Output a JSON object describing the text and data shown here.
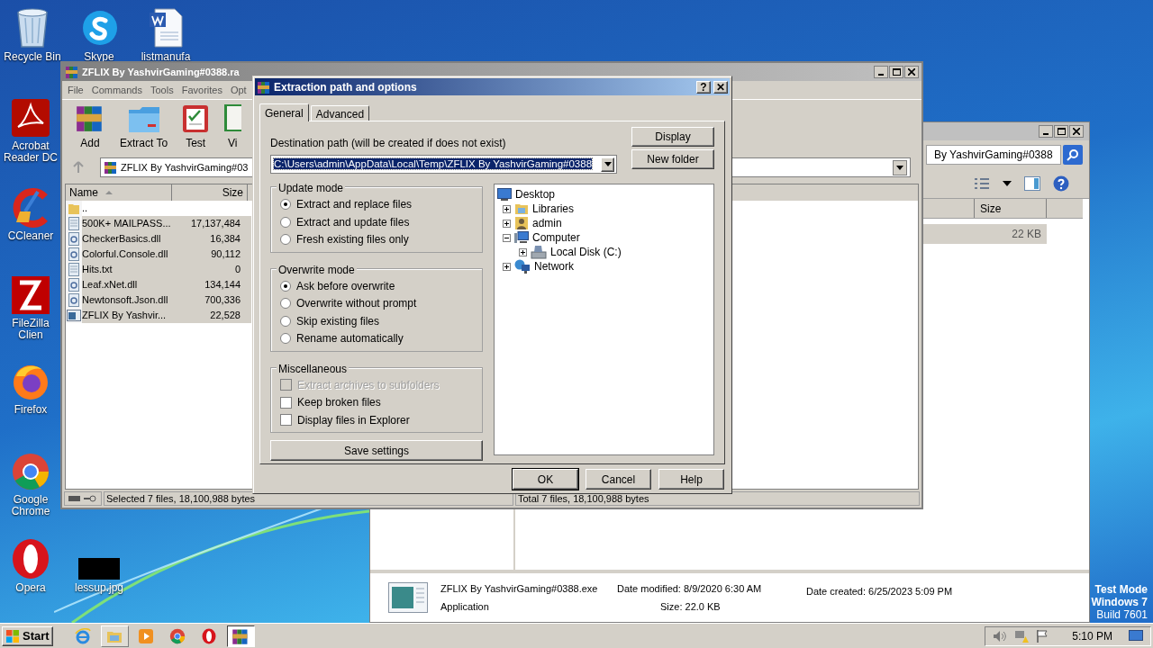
{
  "desktop": {
    "icons": [
      {
        "label": "Recycle Bin",
        "kind": "recycle"
      },
      {
        "label": "Skype",
        "kind": "skype"
      },
      {
        "label": "listmanufa",
        "kind": "word"
      },
      {
        "label": "Acrobat Reader DC",
        "kind": "acrobat"
      },
      {
        "label": "CCleaner",
        "kind": "ccleaner"
      },
      {
        "label": "FileZilla Clien",
        "kind": "filezilla"
      },
      {
        "label": "Firefox",
        "kind": "firefox"
      },
      {
        "label": "Google Chrome",
        "kind": "chrome"
      },
      {
        "label": "Opera",
        "kind": "opera"
      },
      {
        "label": "lessup.jpg",
        "kind": "image"
      }
    ],
    "os_notice": [
      "Test Mode",
      "Windows 7",
      "Build 7601"
    ]
  },
  "explorer": {
    "search_text": "By YashvirGaming#0388",
    "columns": [
      "Size"
    ],
    "rows": [
      {
        "size": "22 KB",
        "selected": true
      }
    ],
    "details": {
      "name": "ZFLIX By YashvirGaming#0388.exe",
      "type": "Application",
      "modified_label": "Date modified:",
      "modified": "8/9/2020 6:30 AM",
      "size_label": "Size:",
      "size": "22.0 KB",
      "created_label": "Date created:",
      "created": "6/25/2023 5:09 PM"
    }
  },
  "winrar": {
    "title": "ZFLIX By YashvirGaming#0388.ra",
    "menu": [
      "File",
      "Commands",
      "Tools",
      "Favorites",
      "Opt"
    ],
    "toolbar": [
      {
        "label": "Add",
        "kind": "add"
      },
      {
        "label": "Extract To",
        "kind": "extract"
      },
      {
        "label": "Test",
        "kind": "test"
      },
      {
        "label": "Vi",
        "kind": "view"
      }
    ],
    "address": "ZFLIX By YashvirGaming#03",
    "columns": [
      "Name",
      "Size"
    ],
    "files": [
      {
        "name": "..",
        "kind": "up",
        "selected": false
      },
      {
        "name": "500K+ MAILPASS...",
        "size": "17,137,484",
        "kind": "text",
        "selected": true
      },
      {
        "name": "CheckerBasics.dll",
        "size": "16,384",
        "kind": "dll",
        "selected": true
      },
      {
        "name": "Colorful.Console.dll",
        "size": "90,112",
        "kind": "dll",
        "selected": true
      },
      {
        "name": "Hits.txt",
        "size": "0",
        "kind": "text",
        "selected": true
      },
      {
        "name": "Leaf.xNet.dll",
        "size": "134,144",
        "kind": "dll",
        "selected": true
      },
      {
        "name": "Newtonsoft.Json.dll",
        "size": "700,336",
        "kind": "dll",
        "selected": true
      },
      {
        "name": "ZFLIX By Yashvir...",
        "size": "22,528",
        "kind": "exe",
        "selected": true
      }
    ],
    "status_left": "Selected 7 files, 18,100,988 bytes",
    "status_right": "Total 7 files, 18,100,988 bytes"
  },
  "dialog": {
    "title": "Extraction path and options",
    "help_button": "?",
    "close_button": "✕",
    "tabs": [
      {
        "label": "General",
        "selected": true
      },
      {
        "label": "Advanced",
        "selected": false
      }
    ],
    "destination_label": "Destination path (will be created if does not exist)",
    "destination": {
      "value": "C:\\Users\\admin\\AppData\\Local\\Temp\\ZFLIX By YashvirGaming#0388",
      "text_selected": true
    },
    "side_buttons": [
      "Display",
      "New folder"
    ],
    "update_mode": {
      "title": "Update mode",
      "options": [
        {
          "label": "Extract and replace files",
          "selected": true
        },
        {
          "label": "Extract and update files",
          "selected": false
        },
        {
          "label": "Fresh existing files only",
          "selected": false
        }
      ]
    },
    "overwrite_mode": {
      "title": "Overwrite mode",
      "options": [
        {
          "label": "Ask before overwrite",
          "selected": true
        },
        {
          "label": "Overwrite without prompt",
          "selected": false
        },
        {
          "label": "Skip existing files",
          "selected": false
        },
        {
          "label": "Rename automatically",
          "selected": false
        }
      ]
    },
    "miscellaneous": {
      "title": "Miscellaneous",
      "options": [
        {
          "label": "Extract archives to subfolders",
          "checked": false,
          "disabled": true
        },
        {
          "label": "Keep broken files",
          "checked": false,
          "disabled": false
        },
        {
          "label": "Display files in Explorer",
          "checked": false,
          "disabled": false
        }
      ]
    },
    "save_button": "Save settings",
    "tree": {
      "label": "Desktop",
      "kind": "desktop",
      "children": [
        {
          "label": "Libraries",
          "kind": "libraries",
          "expanded": false
        },
        {
          "label": "admin",
          "kind": "user",
          "expanded": false
        },
        {
          "label": "Computer",
          "kind": "computer",
          "expanded": true,
          "children": [
            {
              "label": "Local Disk (C:)",
              "kind": "disk",
              "expanded": false
            }
          ]
        },
        {
          "label": "Network",
          "kind": "network",
          "expanded": false
        }
      ]
    },
    "buttons": [
      {
        "label": "OK",
        "default": true
      },
      {
        "label": "Cancel",
        "default": false
      },
      {
        "label": "Help",
        "default": false
      }
    ]
  },
  "taskbar": {
    "start": "Start",
    "apps": [
      {
        "kind": "ie",
        "running": false,
        "active": false
      },
      {
        "kind": "folder",
        "running": true,
        "active": false
      },
      {
        "kind": "media",
        "running": false,
        "active": false
      },
      {
        "kind": "chrome",
        "running": false,
        "active": false
      },
      {
        "kind": "opera",
        "running": false,
        "active": false
      },
      {
        "kind": "winrar",
        "running": true,
        "active": true
      }
    ],
    "clock": "5:10 PM"
  }
}
